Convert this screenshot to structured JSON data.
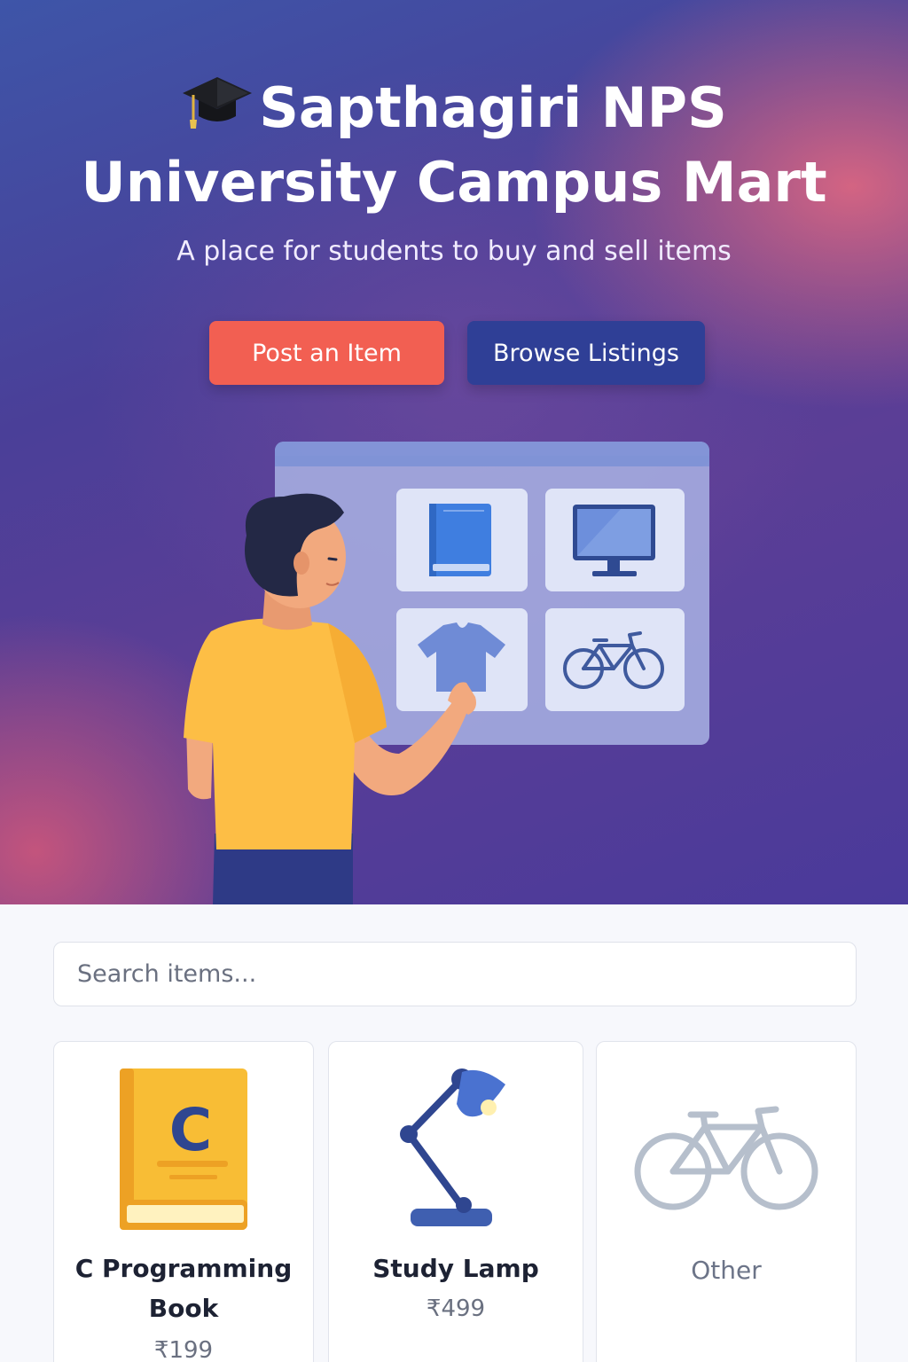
{
  "hero": {
    "title_line1": "Sapthagiri NPS",
    "title_line2": "University Campus Mart",
    "subtitle": "A place for students to buy and sell items",
    "post_button": "Post an Item",
    "browse_button": "Browse Listings",
    "icons": [
      "graduation-cap-icon",
      "book-icon",
      "monitor-icon",
      "tshirt-icon",
      "bicycle-icon"
    ]
  },
  "search": {
    "placeholder": "Search items..."
  },
  "items": [
    {
      "name": "C Programming Book",
      "price": "₹199",
      "icon": "c-book-icon"
    },
    {
      "name": "Study Lamp",
      "price": "₹499",
      "icon": "desk-lamp-icon"
    },
    {
      "name": "Other",
      "icon": "bicycle-icon"
    }
  ],
  "colors": {
    "primary_button": "#f25f52",
    "secondary_button": "#2f3f96",
    "book_yellow": "#f8bd35",
    "lamp_blue": "#3f5fb0"
  }
}
